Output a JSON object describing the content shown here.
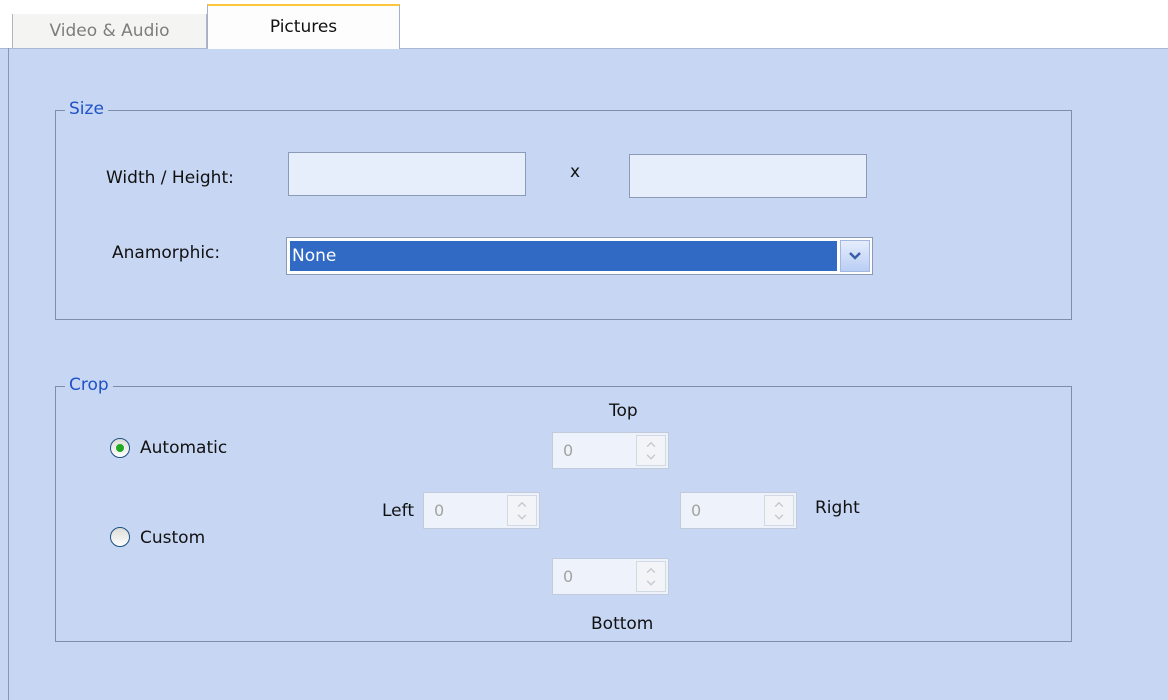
{
  "tabs": {
    "video_audio": "Video & Audio",
    "pictures": "Pictures"
  },
  "size_group": {
    "title": "Size",
    "width_height_label": "Width / Height:",
    "x_separator": "x",
    "width_value": "",
    "height_value": "",
    "anamorphic_label": "Anamorphic:",
    "anamorphic_selected": "None"
  },
  "crop_group": {
    "title": "Crop",
    "automatic_label": "Automatic",
    "custom_label": "Custom",
    "selected_mode": "Automatic",
    "top_label": "Top",
    "left_label": "Left",
    "right_label": "Right",
    "bottom_label": "Bottom",
    "top_value": "0",
    "left_value": "0",
    "right_value": "0",
    "bottom_value": "0"
  },
  "colors": {
    "panel_background": "#c6d6f3",
    "group_title": "#1f52c7",
    "selection_highlight": "#316ac5",
    "active_tab_accent": "#ffc63a",
    "radio_selected": "#22a922"
  },
  "icons": {
    "dropdown": "chevron-down-icon",
    "spinner_up": "arrow-up-icon",
    "spinner_down": "arrow-down-icon"
  }
}
